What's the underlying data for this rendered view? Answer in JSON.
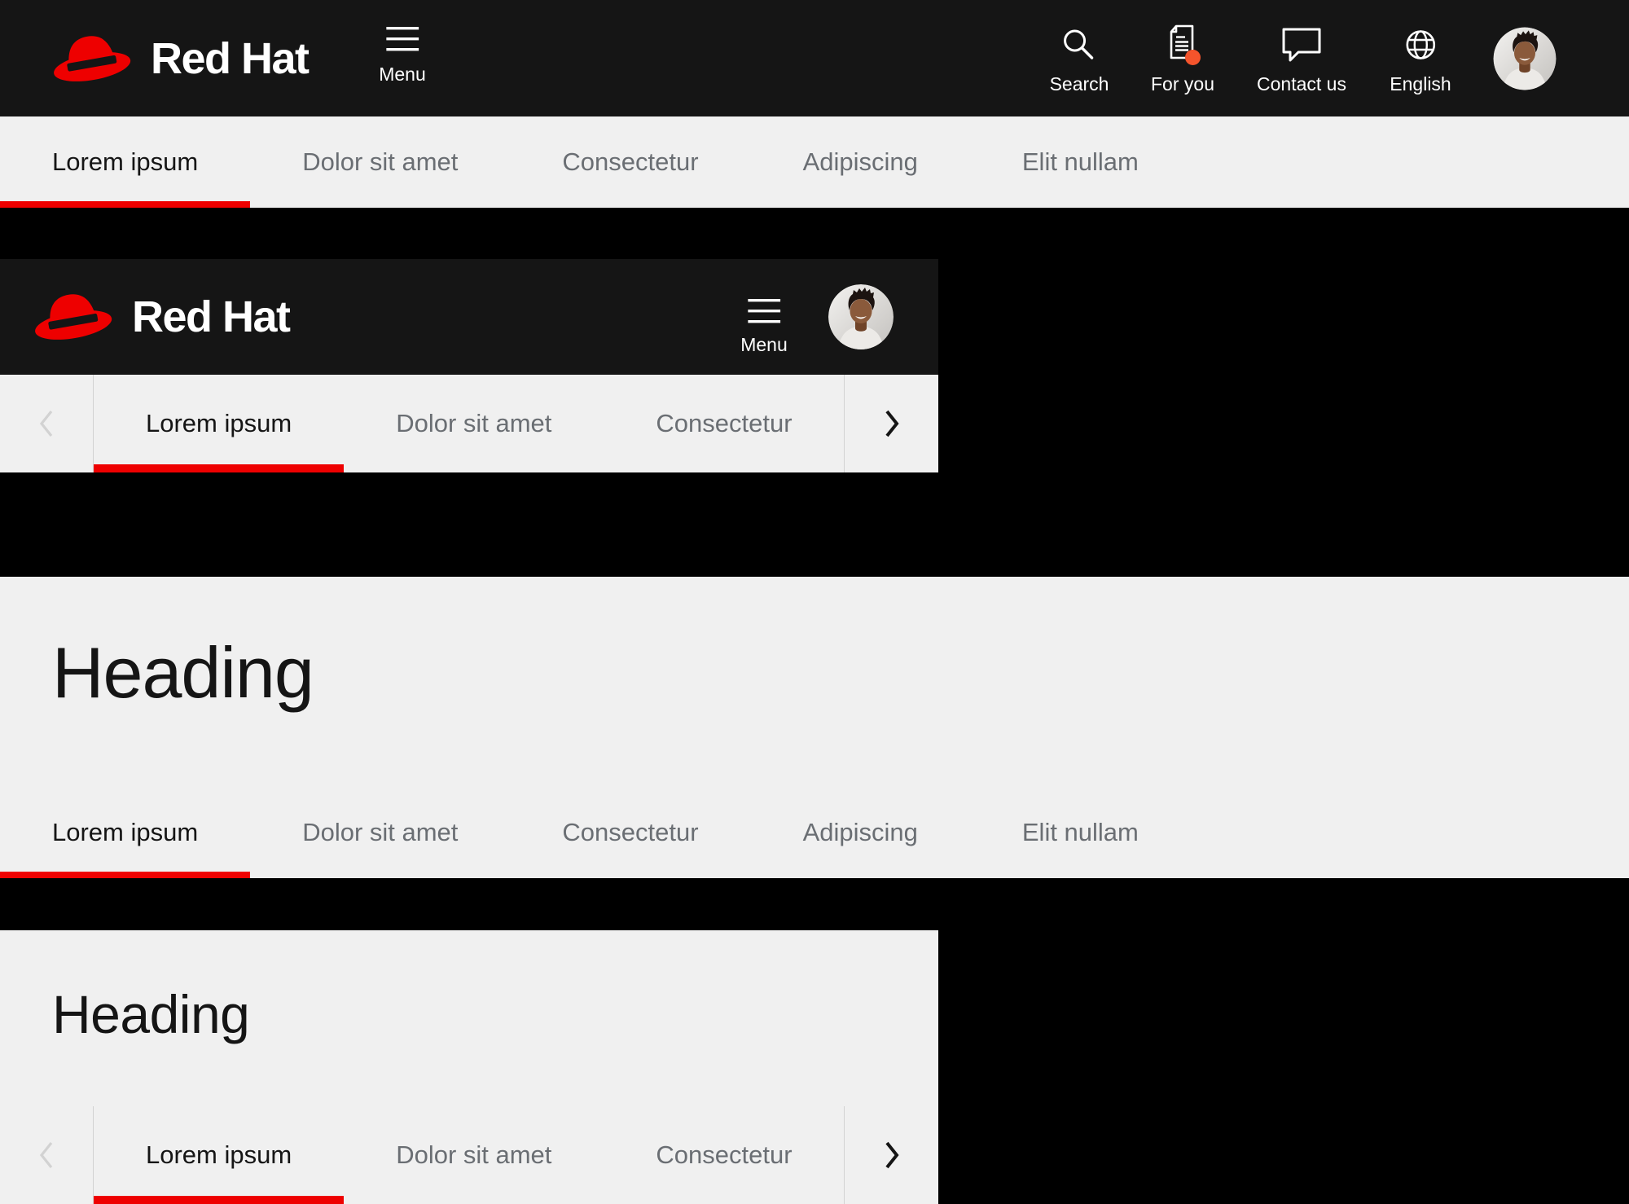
{
  "masthead": {
    "logo_text": "Red Hat",
    "menu_label": "Menu",
    "search_label": "Search",
    "for_you_label": "For you",
    "contact_label": "Contact us",
    "language_label": "English"
  },
  "mobile_masthead": {
    "logo_text": "Red Hat",
    "menu_label": "Menu"
  },
  "tabs": {
    "desktop": [
      "Lorem ipsum",
      "Dolor sit amet",
      "Consectetur",
      "Adipiscing",
      "Elit nullam"
    ],
    "mobile": [
      "Lorem ipsum",
      "Dolor sit amet",
      "Consectetur"
    ],
    "active_tab": "Lorem ipsum"
  },
  "headings": {
    "desktop_heading": "Heading",
    "mobile_heading": "Heading"
  },
  "icons": {
    "logo": "red-fedora-icon",
    "menu": "hamburger-icon",
    "search": "magnifying-glass-icon",
    "for_you": "document-with-notification-dot-icon",
    "contact": "speech-bubble-icon",
    "language": "globe-icon",
    "scroll_left": "chevron-left-icon",
    "scroll_right": "chevron-right-icon",
    "avatar": "user-photo-avatar"
  },
  "colors": {
    "brand_red": "#ee0000",
    "masthead_background": "#151515",
    "canvas_black": "#000000",
    "section_background": "#f0f0f0",
    "active_tab_text": "#151515",
    "inactive_tab_text": "#6a6e73",
    "divider": "#d2d2d2",
    "text_on_dark": "#ffffff",
    "notification_dot": "#f4542c"
  }
}
